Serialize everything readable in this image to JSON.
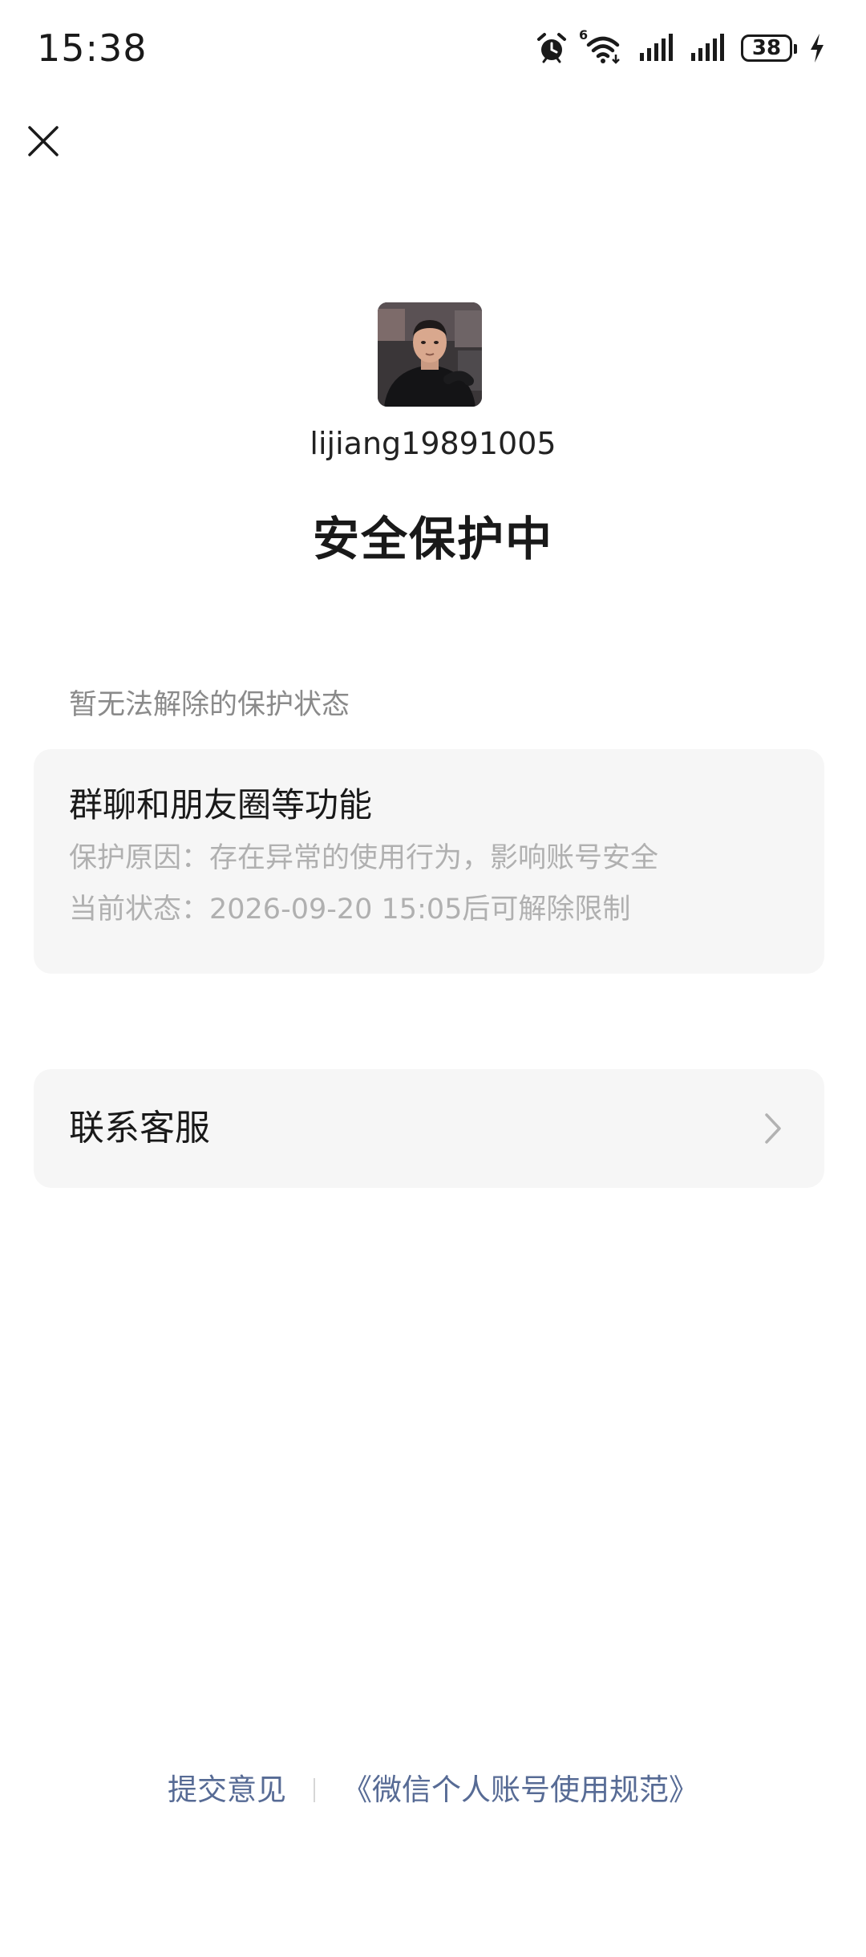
{
  "status_bar": {
    "time": "15:38",
    "network_label": "6",
    "battery_level": "38",
    "icons": [
      "alarm-icon",
      "wifi-icon",
      "signal-icon",
      "signal-icon",
      "battery-icon",
      "charging-icon"
    ]
  },
  "header": {
    "close_icon": "close-icon"
  },
  "profile": {
    "username": "lijiang19891005"
  },
  "page": {
    "title": "安全保护中"
  },
  "restrictions": {
    "section_label": "暂无法解除的保护状态",
    "item": {
      "title": "群聊和朋友圈等功能",
      "reason": "保护原因：存在异常的使用行为，影响账号安全",
      "status": "当前状态：2026-09-20 15:05后可解除限制"
    }
  },
  "support": {
    "label": "联系客服",
    "icon": "chevron-right-icon"
  },
  "footer": {
    "feedback_label": "提交意见",
    "rules_label": "《微信个人账号使用规范》"
  },
  "colors": {
    "link": "#576b95",
    "card_bg": "#f6f6f6",
    "secondary_text": "#8a8a8a",
    "muted_text": "#b0b0b0"
  }
}
